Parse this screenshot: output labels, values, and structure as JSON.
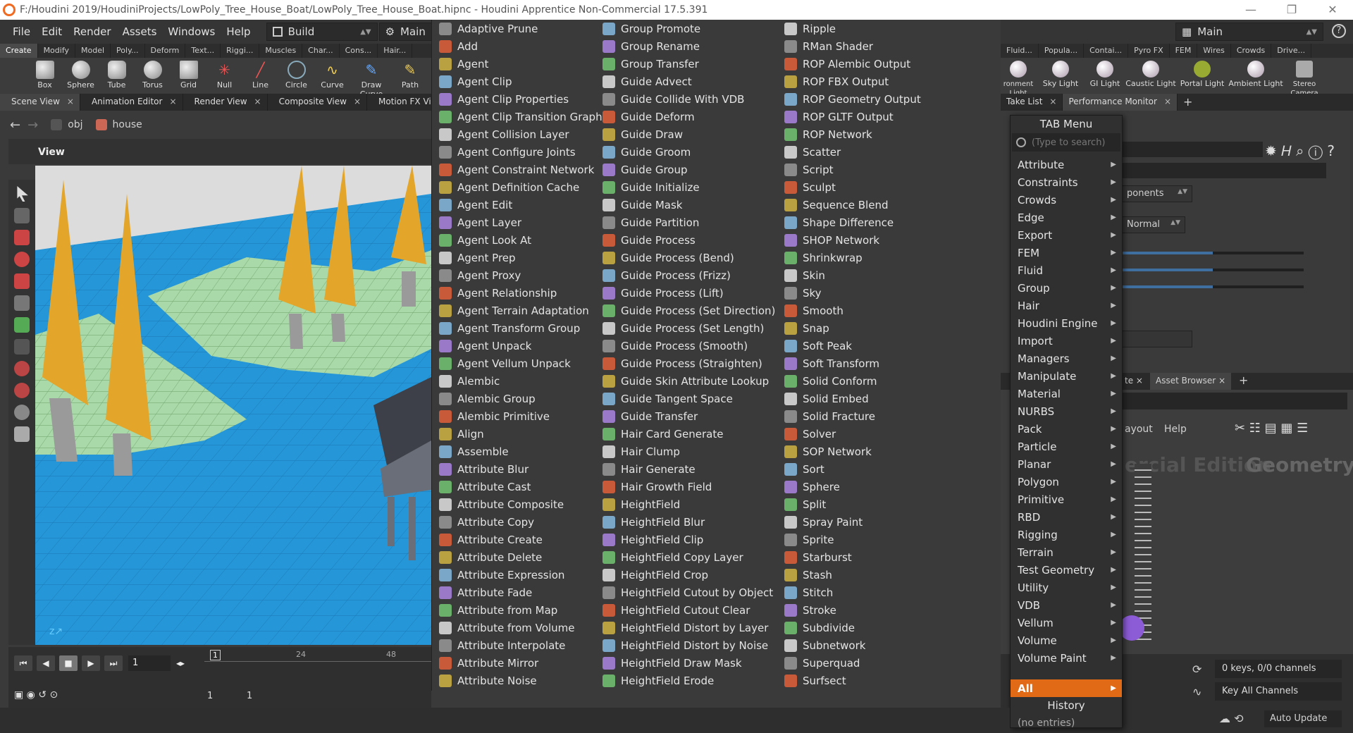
{
  "window": {
    "title": "F:/Houdini 2019/HoudiniProjects/LowPoly_Tree_House_Boat/LowPoly_Tree_House_Boat.hipnc - Houdini Apprentice Non-Commercial 17.5.391",
    "minimize": "—",
    "restore": "❐",
    "close": "✕"
  },
  "menubar": {
    "items": [
      "File",
      "Edit",
      "Render",
      "Assets",
      "Windows",
      "Help"
    ],
    "desktop": "Build",
    "desktop_main": "Main"
  },
  "shelf": {
    "tabs": [
      "Create",
      "Modify",
      "Model",
      "Poly...",
      "Deform",
      "Text...",
      "Riggi...",
      "Muscles",
      "Char...",
      "Cons...",
      "Hair..."
    ],
    "tools": [
      "Box",
      "Sphere",
      "Tube",
      "Torus",
      "Grid",
      "Null",
      "Line",
      "Circle",
      "Curve",
      "Draw Curve",
      "Path"
    ]
  },
  "pane_tabs": [
    "Scene View",
    "Animation Editor",
    "Render View",
    "Composite View",
    "Motion FX View"
  ],
  "path": {
    "root": "obj",
    "node": "house"
  },
  "viewport": {
    "label": "View"
  },
  "playbar": {
    "frame": "1",
    "range_start": "1",
    "range_end": "1",
    "ticks": [
      "1",
      "24",
      "48"
    ]
  },
  "node_columns": [
    [
      "Adaptive Prune",
      "Add",
      "Agent",
      "Agent Clip",
      "Agent Clip Properties",
      "Agent Clip Transition Graph",
      "Agent Collision Layer",
      "Agent Configure Joints",
      "Agent Constraint Network",
      "Agent Definition Cache",
      "Agent Edit",
      "Agent Layer",
      "Agent Look At",
      "Agent Prep",
      "Agent Proxy",
      "Agent Relationship",
      "Agent Terrain Adaptation",
      "Agent Transform Group",
      "Agent Unpack",
      "Agent Vellum Unpack",
      "Alembic",
      "Alembic Group",
      "Alembic Primitive",
      "Align",
      "Assemble",
      "Attribute Blur",
      "Attribute Cast",
      "Attribute Composite",
      "Attribute Copy",
      "Attribute Create",
      "Attribute Delete",
      "Attribute Expression",
      "Attribute Fade",
      "Attribute from Map",
      "Attribute from Volume",
      "Attribute Interpolate",
      "Attribute Mirror",
      "Attribute Noise"
    ],
    [
      "Group Promote",
      "Group Rename",
      "Group Transfer",
      "Guide Advect",
      "Guide Collide With VDB",
      "Guide Deform",
      "Guide Draw",
      "Guide Groom",
      "Guide Group",
      "Guide Initialize",
      "Guide Mask",
      "Guide Partition",
      "Guide Process",
      "Guide Process (Bend)",
      "Guide Process (Frizz)",
      "Guide Process (Lift)",
      "Guide Process (Set Direction)",
      "Guide Process (Set Length)",
      "Guide Process (Smooth)",
      "Guide Process (Straighten)",
      "Guide Skin Attribute Lookup",
      "Guide Tangent Space",
      "Guide Transfer",
      "Hair Card Generate",
      "Hair Clump",
      "Hair Generate",
      "Hair Growth Field",
      "HeightField",
      "HeightField Blur",
      "HeightField Clip",
      "HeightField Copy Layer",
      "HeightField Crop",
      "HeightField Cutout by Object",
      "HeightField Cutout Clear",
      "HeightField Distort by Layer",
      "HeightField Distort by Noise",
      "HeightField Draw Mask",
      "HeightField Erode"
    ],
    [
      "Ripple",
      "RMan Shader",
      "ROP Alembic Output",
      "ROP FBX Output",
      "ROP Geometry Output",
      "ROP GLTF Output",
      "ROP Network",
      "Scatter",
      "Script",
      "Sculpt",
      "Sequence Blend",
      "Shape Difference",
      "SHOP Network",
      "Shrinkwrap",
      "Skin",
      "Sky",
      "Smooth",
      "Snap",
      "Soft Peak",
      "Soft Transform",
      "Solid Conform",
      "Solid Embed",
      "Solid Fracture",
      "Solver",
      "SOP Network",
      "Sort",
      "Sphere",
      "Split",
      "Spray Paint",
      "Sprite",
      "Starburst",
      "Stash",
      "Stitch",
      "Stroke",
      "Subdivide",
      "Subnetwork",
      "Superquad",
      "Surfsect"
    ]
  ],
  "tab_menu": {
    "header": "TAB Menu",
    "search_placeholder": "(Type to search)",
    "categories": [
      "Attribute",
      "Constraints",
      "Crowds",
      "Edge",
      "Export",
      "FEM",
      "Fluid",
      "Group",
      "Hair",
      "Houdini Engine",
      "Import",
      "Managers",
      "Manipulate",
      "Material",
      "NURBS",
      "Pack",
      "Particle",
      "Planar",
      "Polygon",
      "Primitive",
      "RBD",
      "Rigging",
      "Terrain",
      "Test Geometry",
      "Utility",
      "VDB",
      "Vellum",
      "Volume",
      "Volume Paint"
    ],
    "selected": "All",
    "history": "History",
    "history_note": "(no entries)"
  },
  "right_panel": {
    "desktop": "Main",
    "shelf_tabs": [
      "Fluid...",
      "Popula...",
      "Contai...",
      "Pyro FX",
      "FEM",
      "Wires",
      "Crowds",
      "Drive..."
    ],
    "light_tools": [
      "ronment\nLight",
      "Sky Light",
      "GI Light",
      "Caustic Light",
      "Portal Light",
      "Ambient Light",
      "Stereo\nCamera"
    ],
    "pane_tabs": [
      "Take List",
      "Performance Monitor"
    ],
    "param_components": "ponents",
    "param_normal": "Normal",
    "slider_values": [
      0.5,
      0.5,
      0.5
    ],
    "lower_tabs": [
      "te",
      "Asset Browser"
    ],
    "net_menu": [
      "ayout",
      "Help"
    ],
    "watermark_left": "ercial Edition",
    "watermark_right": "Geometry",
    "keys_info": "0 keys, 0/0 channels",
    "key_all": "Key All Channels",
    "auto_update": "Auto Update"
  },
  "colors": {
    "accent": "#e06a15",
    "water": "#2596d8",
    "tree_leaf": "#e3a52a",
    "ground": "#a9d9a8"
  }
}
